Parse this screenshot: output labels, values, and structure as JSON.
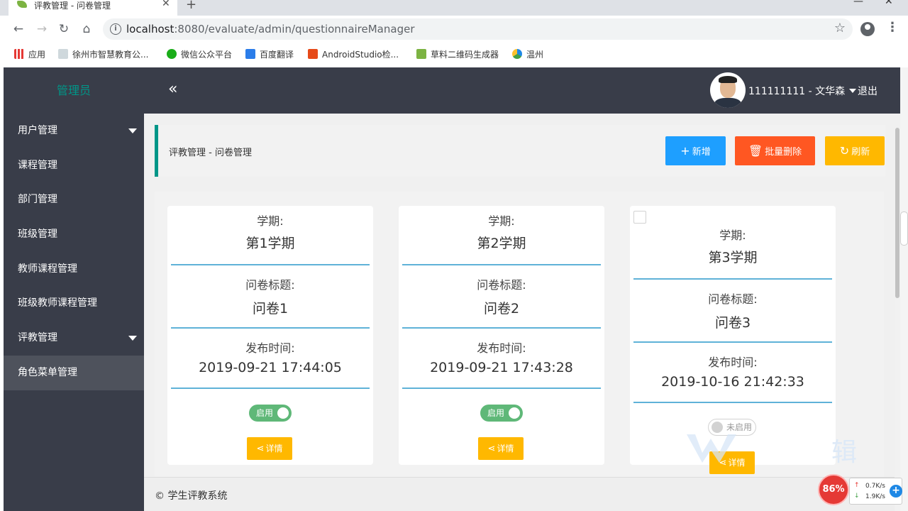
{
  "browser": {
    "tab_title": "评教管理 - 问卷管理",
    "url_host": "localhost",
    "url_rest": ":8080/evaluate/admin/questionnaireManager",
    "bookmarks": [
      "应用",
      "徐州市智慧教育公...",
      "微信公众平台",
      "百度翻译",
      "AndroidStudio检...",
      "草料二维码生成器",
      "温州"
    ]
  },
  "app": {
    "brand": "管理员",
    "collapse_glyph": "«",
    "user_label": "111111111 - 文华森",
    "logout": "退出",
    "sidebar": [
      {
        "label": "用户管理",
        "has_caret": true
      },
      {
        "label": "课程管理"
      },
      {
        "label": "部门管理"
      },
      {
        "label": "班级管理"
      },
      {
        "label": "教师课程管理"
      },
      {
        "label": "班级教师课程管理"
      },
      {
        "label": "评教管理",
        "has_caret": true
      },
      {
        "label": "角色菜单管理",
        "active": true
      }
    ],
    "breadcrumb": "评教管理 - 问卷管理",
    "buttons": {
      "add": "新增",
      "delete": "批量删除",
      "refresh": "刷新"
    },
    "field_labels": {
      "term": "学期:",
      "title": "问卷标题:",
      "date": "发布时间:"
    },
    "cards": [
      {
        "term": "第1学期",
        "title": "问卷1",
        "date": "2019-09-21 17:44:05",
        "status": "启用",
        "detail": "详情"
      },
      {
        "term": "第2学期",
        "title": "问卷2",
        "date": "2019-09-21 17:43:28",
        "status": "启用",
        "detail": "详情"
      },
      {
        "term": "第3学期",
        "title": "问卷3",
        "date": "2019-10-16 21:42:33",
        "status": "未启用",
        "detail": "详情"
      }
    ],
    "footer": "© 学生评教系统"
  },
  "net_widget": {
    "percent": "86%",
    "up": "0.7K/s",
    "down": "1.9K/s"
  },
  "colors": {
    "accent": "#009688",
    "sidebar": "#393d49",
    "blue": "#1e9fff",
    "orange_red": "#ff5722",
    "yellow": "#ffb800",
    "green": "#5fb878",
    "divider": "#5fb2d8"
  }
}
